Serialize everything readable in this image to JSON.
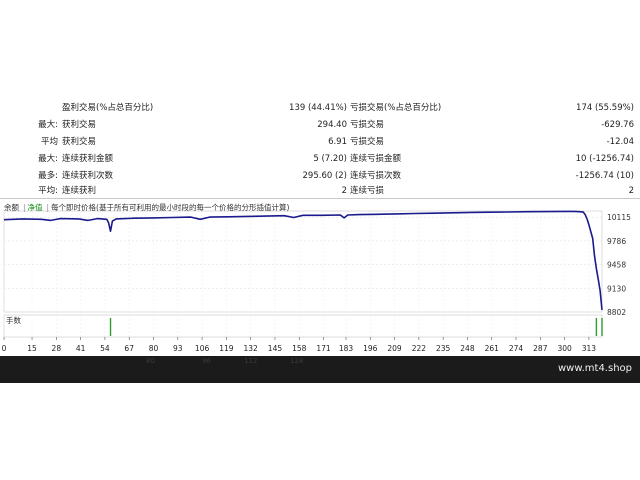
{
  "stats": {
    "rows": [
      {
        "prefix": "",
        "label": "盈利交易(%占总百分比)",
        "value": "139 (44.41%)",
        "label2": "亏损交易(%占总百分比)",
        "value2": "174 (55.59%)"
      },
      {
        "prefix": "最大:",
        "label": "获利交易",
        "value": "294.40",
        "label2": "亏损交易",
        "value2": "-629.76"
      },
      {
        "prefix": "平均",
        "label": "获利交易",
        "value": "6.91",
        "label2": "亏损交易",
        "value2": "-12.04"
      },
      {
        "prefix": "最大:",
        "label": "连续获利金额",
        "value": "5 (7.20)",
        "label2": "连续亏损金额",
        "value2": "10 (-1256.74)"
      },
      {
        "prefix": "最多:",
        "label": "连续获利次数",
        "value": "295.60 (2)",
        "label2": "连续亏损次数",
        "value2": "-1256.74 (10)"
      },
      {
        "prefix": "平均:",
        "label": "连续获利",
        "value": "2",
        "label2": "连续亏损",
        "value2": "2"
      }
    ]
  },
  "chart": {
    "legend": {
      "balance": "余额",
      "equity": "净值",
      "description": "每个即时价格(基于所有可利用的最小时段的每一个价格的分形插值计算)"
    },
    "volume_label": "手数",
    "line_color": "#1a1a8c",
    "volume_color": "#2e9e2e",
    "watermark": "www.mt4.shop",
    "faded_ticks": [
      {
        "label": "80",
        "color": "#3a3a3a"
      },
      {
        "label": "96",
        "color": "#3a3a3a"
      },
      {
        "label": "112",
        "color": "#3a3a3a"
      },
      {
        "label": "128",
        "color": "#3a3a3a"
      }
    ]
  },
  "chart_data": {
    "type": "line",
    "title": "",
    "xlabel": "",
    "ylabel": "",
    "xlim": [
      0,
      320
    ],
    "ylim": [
      8802,
      10200
    ],
    "x_ticks": [
      0,
      15,
      28,
      41,
      54,
      67,
      80,
      93,
      106,
      119,
      132,
      145,
      158,
      171,
      183,
      196,
      209,
      222,
      235,
      248,
      261,
      274,
      287,
      300,
      313
    ],
    "y_ticks": [
      10115,
      9786,
      9458,
      9130,
      8802
    ],
    "series": [
      {
        "x": [
          0,
          10,
          20,
          25,
          30,
          40,
          45,
          50,
          55,
          56,
          57,
          58,
          60,
          70,
          80,
          90,
          100,
          105,
          110,
          120,
          130,
          140,
          150,
          155,
          160,
          170,
          180,
          182,
          184,
          190,
          200,
          210,
          220,
          230,
          240,
          250,
          260,
          270,
          280,
          290,
          300,
          305,
          308,
          310,
          311,
          312,
          313,
          315,
          316,
          317,
          318,
          319,
          320
        ],
        "y": [
          10080,
          10090,
          10085,
          10070,
          10095,
          10090,
          10070,
          10095,
          10085,
          10035,
          9920,
          10060,
          10090,
          10100,
          10105,
          10110,
          10115,
          10085,
          10115,
          10120,
          10125,
          10130,
          10135,
          10110,
          10140,
          10140,
          10145,
          10105,
          10145,
          10150,
          10155,
          10160,
          10165,
          10170,
          10175,
          10180,
          10183,
          10186,
          10190,
          10192,
          10195,
          10195,
          10190,
          10185,
          10150,
          10090,
          10010,
          9820,
          9580,
          9400,
          9250,
          9100,
          8830
        ]
      }
    ],
    "volume_bars": [
      {
        "x": 57,
        "v": 1
      },
      {
        "x": 317,
        "v": 1
      },
      {
        "x": 320,
        "v": 1
      }
    ]
  }
}
